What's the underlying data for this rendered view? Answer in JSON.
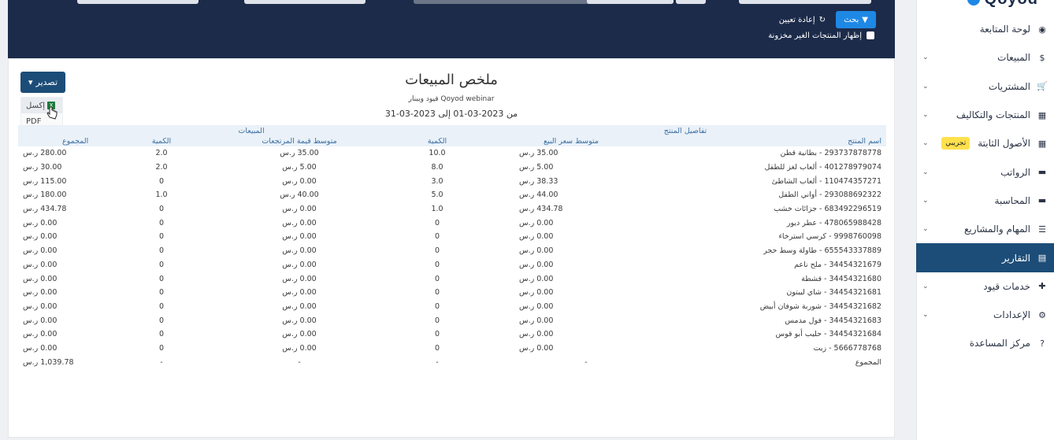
{
  "sidebar": {
    "logo": "Qoyod",
    "items": [
      {
        "label": "لوحة المتابعة",
        "icon": "dashboard-icon",
        "glyph": "◉",
        "chevron": false
      },
      {
        "label": "المبيعات",
        "icon": "dollar-icon",
        "glyph": "$",
        "chevron": true
      },
      {
        "label": "المشتريات",
        "icon": "cart-icon",
        "glyph": "🛒",
        "chevron": true
      },
      {
        "label": "المنتجات والتكاليف",
        "icon": "grid-icon",
        "glyph": "▦",
        "chevron": true
      },
      {
        "label": "الأصول الثابتة",
        "icon": "grid-icon",
        "glyph": "▦",
        "chevron": true,
        "badge": "تجريبي"
      },
      {
        "label": "الرواتب",
        "icon": "folder-icon",
        "glyph": "▬",
        "chevron": true
      },
      {
        "label": "المحاسبة",
        "icon": "folder-icon",
        "glyph": "▬",
        "chevron": true
      },
      {
        "label": "المهام والمشاريع",
        "icon": "list-icon",
        "glyph": "☰",
        "chevron": true
      },
      {
        "label": "التقارير",
        "icon": "report-icon",
        "glyph": "▤",
        "chevron": false,
        "active": true
      },
      {
        "label": "خدمات قيود",
        "icon": "puzzle-icon",
        "glyph": "✚",
        "chevron": true
      },
      {
        "label": "الإعدادات",
        "icon": "gear-icon",
        "glyph": "⚙",
        "chevron": true
      },
      {
        "label": "مركز المساعدة",
        "icon": "help-icon",
        "glyph": "?",
        "chevron": false
      }
    ]
  },
  "filters": {
    "search_label": "بحث",
    "reset_label": "إعادة تعيين",
    "show_unstocked_label": "إظهار المنتجات الغير مخزونة"
  },
  "report": {
    "title": "ملخص المبيعات",
    "company": "قيود ويبنار Qoyod webinar",
    "date_range": "من 2023-03-01 إلى 2023-03-31",
    "export_label": "تصدير",
    "export_options": [
      "إكسل",
      "PDF"
    ],
    "group_headers": {
      "product": "تفاصيل المنتج",
      "sales": "المبيعات"
    },
    "columns": [
      "اسم المنتج",
      "متوسط سعر البيع",
      "الكمية",
      "متوسط قيمة المرتجعات",
      "الكمية",
      "المجموع"
    ],
    "rows": [
      [
        "293737878778 - بطانية قطن",
        "35.00 ر.س",
        "10.0",
        "35.00 ر.س",
        "2.0",
        "280.00 ر.س"
      ],
      [
        "401278979074 - ألعاب لغز للطفل",
        "5.00 ر.س",
        "8.0",
        "5.00 ر.س",
        "2.0",
        "30.00 ر.س"
      ],
      [
        "110474357271 - ألعاب الشاطئ",
        "38.33 ر.س",
        "3.0",
        "0.00 ر.س",
        "0",
        "115.00 ر.س"
      ],
      [
        "293088692322 - أواني الطفل",
        "44.00 ر.س",
        "5.0",
        "40.00 ر.س",
        "1.0",
        "180.00 ر.س"
      ],
      [
        "683492296519 - جزائات خشب",
        "434.78 ر.س",
        "1.0",
        "0.00 ر.س",
        "0",
        "434.78 ر.س"
      ],
      [
        "478065988428 - عطر ديور",
        "0.00 ر.س",
        "0",
        "0.00 ر.س",
        "0",
        "0.00 ر.س"
      ],
      [
        "9998760098 - كرسي استرخاء",
        "0.00 ر.س",
        "0",
        "0.00 ر.س",
        "0",
        "0.00 ر.س"
      ],
      [
        "655543337889 - طاولة وسط حجر",
        "0.00 ر.س",
        "0",
        "0.00 ر.س",
        "0",
        "0.00 ر.س"
      ],
      [
        "34454321679 - ملح ناعم",
        "0.00 ر.س",
        "0",
        "0.00 ر.س",
        "0",
        "0.00 ر.س"
      ],
      [
        "34454321680 - قشطة",
        "0.00 ر.س",
        "0",
        "0.00 ر.س",
        "0",
        "0.00 ر.س"
      ],
      [
        "34454321681 - شاي ليبتون",
        "0.00 ر.س",
        "0",
        "0.00 ر.س",
        "0",
        "0.00 ر.س"
      ],
      [
        "34454321682 - شوربة شوفان أبيض",
        "0.00 ر.س",
        "0",
        "0.00 ر.س",
        "0",
        "0.00 ر.س"
      ],
      [
        "34454321683 - فول مدمس",
        "0.00 ر.س",
        "0",
        "0.00 ر.س",
        "0",
        "0.00 ر.س"
      ],
      [
        "34454321684 - حليب أبو قوس",
        "0.00 ر.س",
        "0",
        "0.00 ر.س",
        "0",
        "0.00 ر.س"
      ],
      [
        "5666778768 - زيت",
        "0.00 ر.س",
        "0",
        "0.00 ر.س",
        "0",
        "0.00 ر.س"
      ]
    ],
    "total_row": [
      "المجموع",
      "-",
      "-",
      "-",
      "-",
      "1,039.78 ر.س"
    ]
  }
}
